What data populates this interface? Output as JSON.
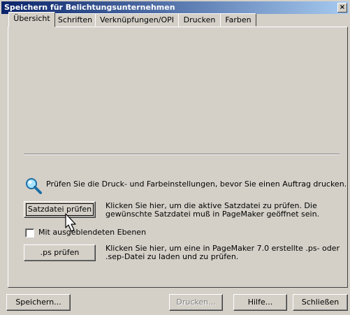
{
  "window": {
    "title": "Speichern für Belichtungsunternehmen",
    "close_glyph": "×"
  },
  "tabs": [
    {
      "label": "Übersicht",
      "active": true
    },
    {
      "label": "Schriften",
      "active": false
    },
    {
      "label": "Verknüpfungen/OPI",
      "active": false
    },
    {
      "label": "Drucken",
      "active": false
    },
    {
      "label": "Farben",
      "active": false
    }
  ],
  "info": {
    "text": "Prüfen Sie die Druck- und Farbeinstellungen, bevor Sie einen Auftrag drucken.",
    "icon": "search-icon"
  },
  "check_publication": {
    "button_label": "Satzdatei prüfen",
    "desc_line1": "Klicken Sie hier, um die aktive Satzdatei zu prüfen. Die",
    "desc_line2": "gewünschte Satzdatei muß in PageMaker geöffnet sein."
  },
  "hidden_layers": {
    "label": "Mit ausgeblendeten Ebenen",
    "checked": false
  },
  "check_ps": {
    "button_label": ".ps prüfen",
    "desc_line1": "Klicken Sie hier, um eine in PageMaker 7.0 erstellte .ps- oder",
    "desc_line2": ".sep-Datei zu laden und zu prüfen."
  },
  "footer": {
    "save": "Speichern...",
    "print": "Drucken...",
    "help": "Hilfe...",
    "close": "Schließen"
  }
}
